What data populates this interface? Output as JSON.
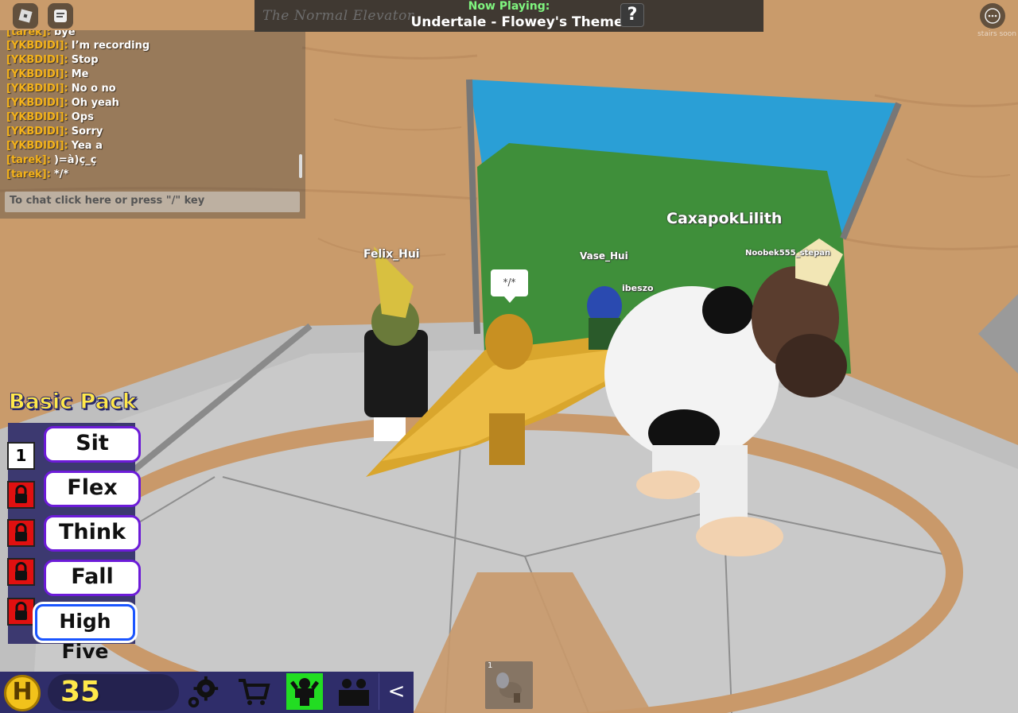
{
  "now_playing": {
    "logo_text": "The Normal Elevator",
    "label": "Now Playing:",
    "track": "Undertale - Flowey's Theme",
    "help": "?"
  },
  "top_right": {
    "hint": "stairs soon"
  },
  "chat": {
    "messages": [
      {
        "user": "[tarek]:",
        "text": "bye"
      },
      {
        "user": "[YKBDIDI]:",
        "text": "I’m recording"
      },
      {
        "user": "[YKBDIDI]:",
        "text": "Stop"
      },
      {
        "user": "[YKBDIDI]:",
        "text": "Me"
      },
      {
        "user": "[YKBDIDI]:",
        "text": "No o no"
      },
      {
        "user": "[YKBDIDI]:",
        "text": "Oh yeah"
      },
      {
        "user": "[YKBDIDI]:",
        "text": "Ops"
      },
      {
        "user": "[YKBDIDI]:",
        "text": "Sorry"
      },
      {
        "user": "[YKBDIDI]:",
        "text": "Yea a"
      },
      {
        "user": "[tarek]:",
        "text": ")=à)ç_ç"
      },
      {
        "user": "[tarek]:",
        "text": "*/*"
      }
    ],
    "input_placeholder": "To chat click here or press \"/\" key"
  },
  "players": {
    "felix": "Felix_Hui",
    "vase": "Vase_Hui",
    "caxapok": "CaxapokLilith",
    "noobek": "Noobek555_stepan",
    "ibeszo": "ibeszo"
  },
  "speech_bubble": "*/*",
  "emote_pack": {
    "title": "Basic Pack",
    "slot_number": "1",
    "emotes": [
      "Sit",
      "Flex",
      "Think",
      "Fall",
      "High Five"
    ]
  },
  "bottom_bar": {
    "coin_letter": "H",
    "coins": "35",
    "collapse": "<"
  },
  "hotbar": {
    "slot_number": "1"
  },
  "colors": {
    "chat_name": "#f4b21a",
    "now_playing_label": "#7ff57f",
    "emote_border": "#6c1bd8",
    "emote_active_border": "#1a55ff",
    "coin_text": "#ffe84a",
    "panel": "#3c3970"
  }
}
